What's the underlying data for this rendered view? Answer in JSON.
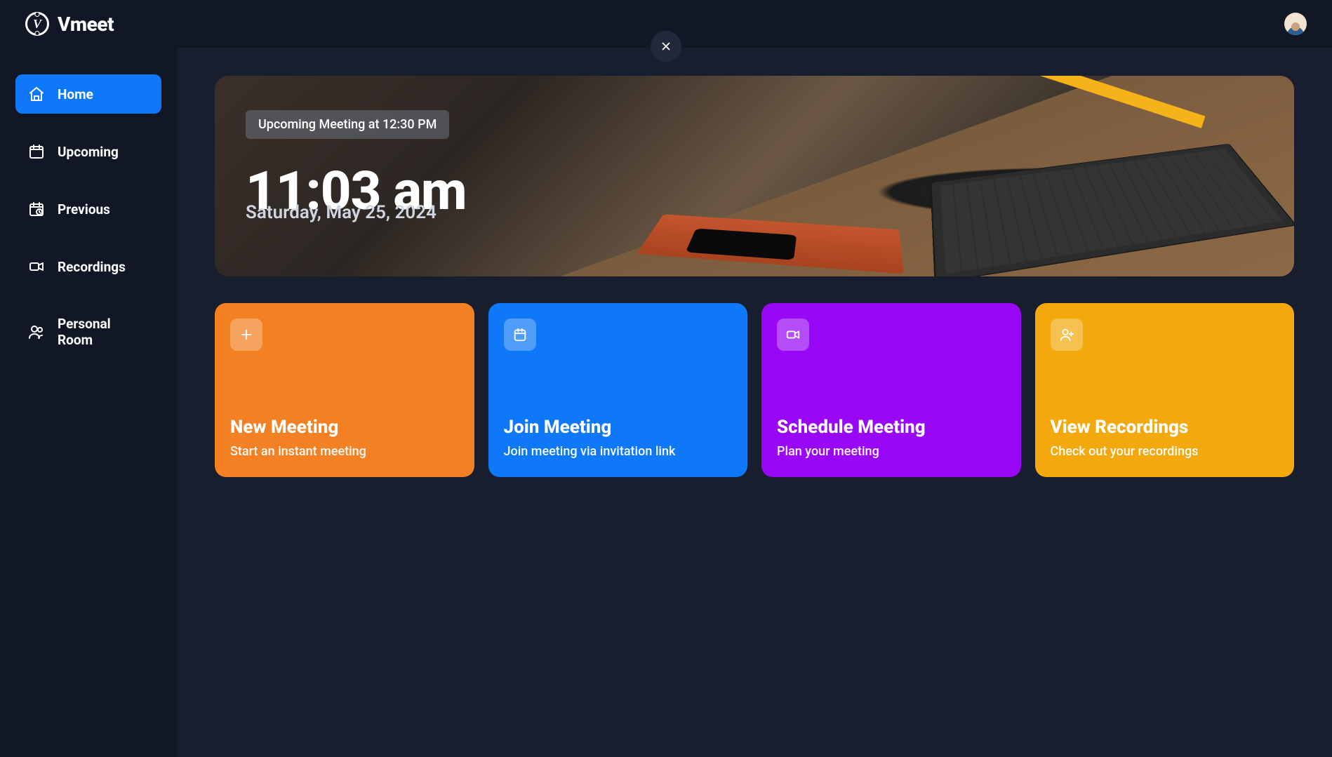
{
  "brand": {
    "wordmark": "Vmeet",
    "mark_letter": "V"
  },
  "sidebar": {
    "items": [
      {
        "label": "Home",
        "icon": "home",
        "active": true
      },
      {
        "label": "Upcoming",
        "icon": "calendar",
        "active": false
      },
      {
        "label": "Previous",
        "icon": "history",
        "active": false
      },
      {
        "label": "Recordings",
        "icon": "video",
        "active": false
      },
      {
        "label": "Personal Room",
        "icon": "users",
        "active": false
      }
    ]
  },
  "hero": {
    "pill": "Upcoming Meeting at 12:30 PM",
    "time": "11:03 am",
    "date": "Saturday, May 25, 2024"
  },
  "cards": [
    {
      "title": "New Meeting",
      "subtitle": "Start an instant meeting",
      "color": "orange",
      "icon": "plus"
    },
    {
      "title": "Join Meeting",
      "subtitle": "Join meeting via invitation link",
      "color": "blue",
      "icon": "calendar"
    },
    {
      "title": "Schedule Meeting",
      "subtitle": "Plan your meeting",
      "color": "purple",
      "icon": "video"
    },
    {
      "title": "View Recordings",
      "subtitle": "Check out your recordings",
      "color": "amber",
      "icon": "user-plus"
    }
  ],
  "colors": {
    "bg_shell": "#121726",
    "bg_main": "#191e2e",
    "accent": "#0e78f9",
    "orange": "#f38022",
    "purple": "#9808f6",
    "amber": "#f3a90e"
  }
}
